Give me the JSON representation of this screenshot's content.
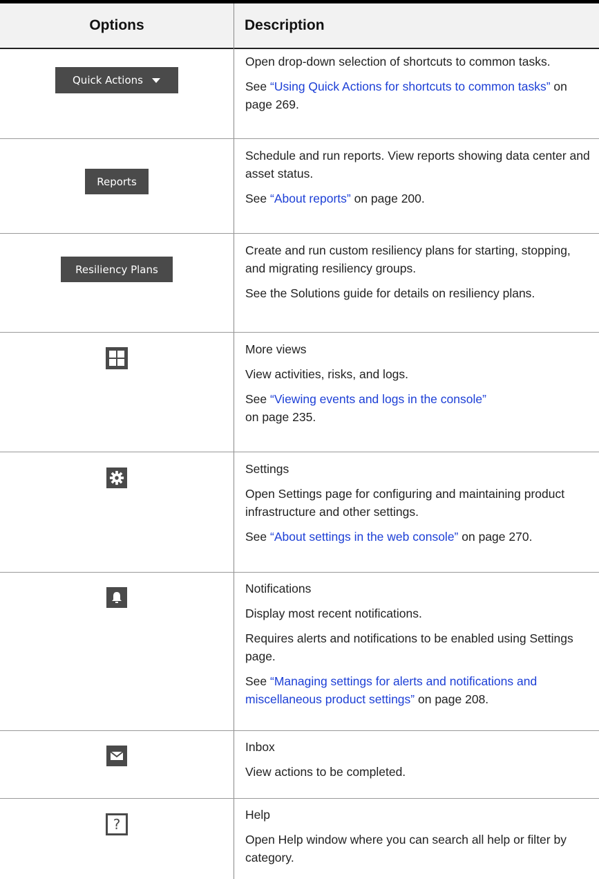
{
  "table": {
    "headers": {
      "options": "Options",
      "description": "Description"
    },
    "rows": [
      {
        "option_label": "Quick Actions",
        "icon": "quick-actions-button",
        "paragraphs": [
          {
            "text": "Open drop-down selection of shortcuts to common tasks."
          },
          {
            "prefix": "See ",
            "link": "“Using Quick Actions for shortcuts to common tasks”",
            "suffix": " on page 269."
          }
        ]
      },
      {
        "option_label": "Reports",
        "icon": "reports-button",
        "paragraphs": [
          {
            "text": "Schedule and run reports. View reports showing data center and asset status."
          },
          {
            "prefix": "See ",
            "link": "“About reports”",
            "suffix": " on page 200."
          }
        ]
      },
      {
        "option_label": "Resiliency Plans",
        "icon": "resiliency-plans-button",
        "paragraphs": [
          {
            "text": "Create and run custom resiliency plans for starting, stopping, and migrating resiliency groups."
          },
          {
            "text": "See the Solutions guide for details on resiliency plans."
          }
        ]
      },
      {
        "icon": "more-views-icon",
        "paragraphs": [
          {
            "text": "More views"
          },
          {
            "text": "View activities, risks, and logs."
          },
          {
            "prefix": "See ",
            "link": "“Viewing events and logs in the console”",
            "suffix": "on page 235."
          }
        ]
      },
      {
        "icon": "gear-icon",
        "paragraphs": [
          {
            "text": "Settings"
          },
          {
            "text": "Open Settings page for configuring and maintaining product infrastructure and other settings."
          },
          {
            "prefix": "See ",
            "link": "“About settings in the web console”",
            "suffix": " on page 270."
          }
        ]
      },
      {
        "icon": "bell-icon",
        "paragraphs": [
          {
            "text": "Notifications"
          },
          {
            "text": "Display most recent notifications."
          },
          {
            "text": "Requires alerts and notifications to be enabled using Settings page."
          },
          {
            "prefix": "See ",
            "link": "“Managing settings for alerts and notifications and miscellaneous product settings”",
            "suffix": " on page 208."
          }
        ]
      },
      {
        "icon": "envelope-icon",
        "paragraphs": [
          {
            "text": "Inbox"
          },
          {
            "text": "View actions to be completed."
          }
        ]
      },
      {
        "icon": "question-mark-icon",
        "paragraphs": [
          {
            "text": "Help"
          },
          {
            "text": "Open Help window where you can search all help or filter by category."
          }
        ]
      }
    ]
  },
  "colors": {
    "button_bg": "#4a4a4a",
    "link": "#1c3fd6",
    "header_bg": "#f2f2f2"
  }
}
